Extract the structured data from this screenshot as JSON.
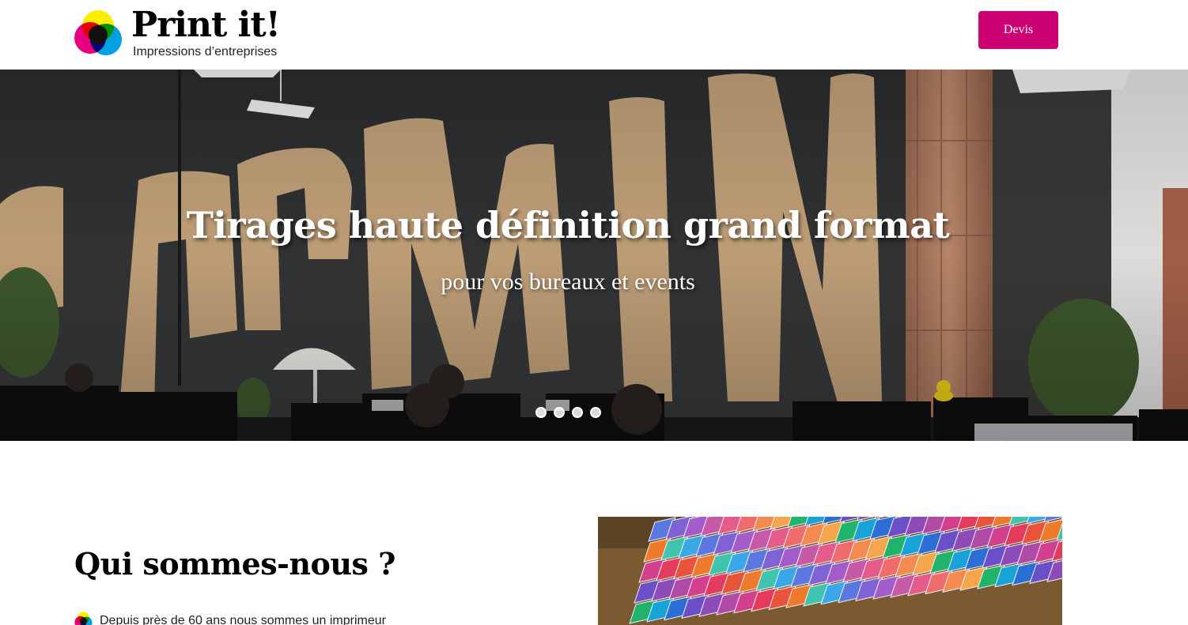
{
  "header": {
    "logo_title": "Print it!",
    "logo_tagline": "Impressions d’entreprises",
    "devis_label": "Devis"
  },
  "hero": {
    "title": "Tirages haute définition grand format",
    "subtitle": "pour vos bureaux et events",
    "slides_count": 4
  },
  "about": {
    "title": "Qui sommes-nous ?",
    "intro": "Depuis près de 60 ans nous sommes un imprimeur"
  },
  "colors": {
    "brand": "#cd0073",
    "cyan": "#00a0e3",
    "magenta": "#e6007e",
    "yellow": "#ffed00"
  },
  "icons": {
    "logo": "cmyk-circles-icon",
    "bullet": "cmyk-circles-icon"
  }
}
